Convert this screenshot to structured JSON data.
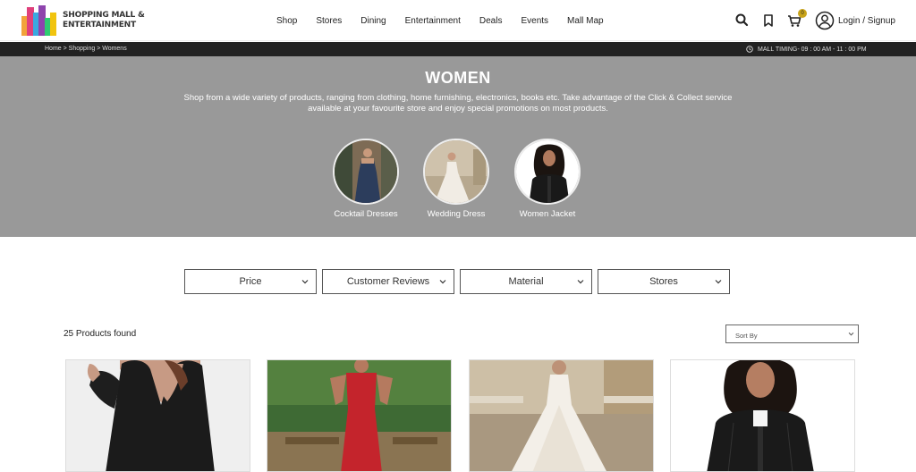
{
  "header": {
    "logo_line1": "SHOPPING MALL &",
    "logo_line2": "ENTERTAINMENT",
    "nav": [
      "Shop",
      "Stores",
      "Dining",
      "Entertainment",
      "Deals",
      "Events",
      "Mall Map"
    ],
    "cart_count": "0",
    "login_label": "Login / Signup",
    "icons": [
      "search-icon",
      "bookmark-icon",
      "cart-icon",
      "user-icon"
    ]
  },
  "subbar": {
    "breadcrumb": "Home > Shopping > Womens",
    "timing": "MALL TIMING- 09 : 00 AM - 11 : 00 PM"
  },
  "hero": {
    "title": "WOMEN",
    "description": "Shop from a wide variety of products, ranging from clothing, home furnishing, electronics, books etc. Take advantage of the Click & Collect service available at your favourite store and enjoy special promotions on most products.",
    "categories": [
      "Cocktail Dresses",
      "Wedding Dress",
      "Women Jacket"
    ]
  },
  "filters": [
    "Price",
    "Customer Reviews",
    "Material",
    "Stores"
  ],
  "results": {
    "count_text": "25 Products found",
    "sort_label": "Sort By"
  },
  "colors": {
    "hero_bg": "#999999",
    "subbar_bg": "#222222",
    "cart_badge": "#c9a41a"
  }
}
